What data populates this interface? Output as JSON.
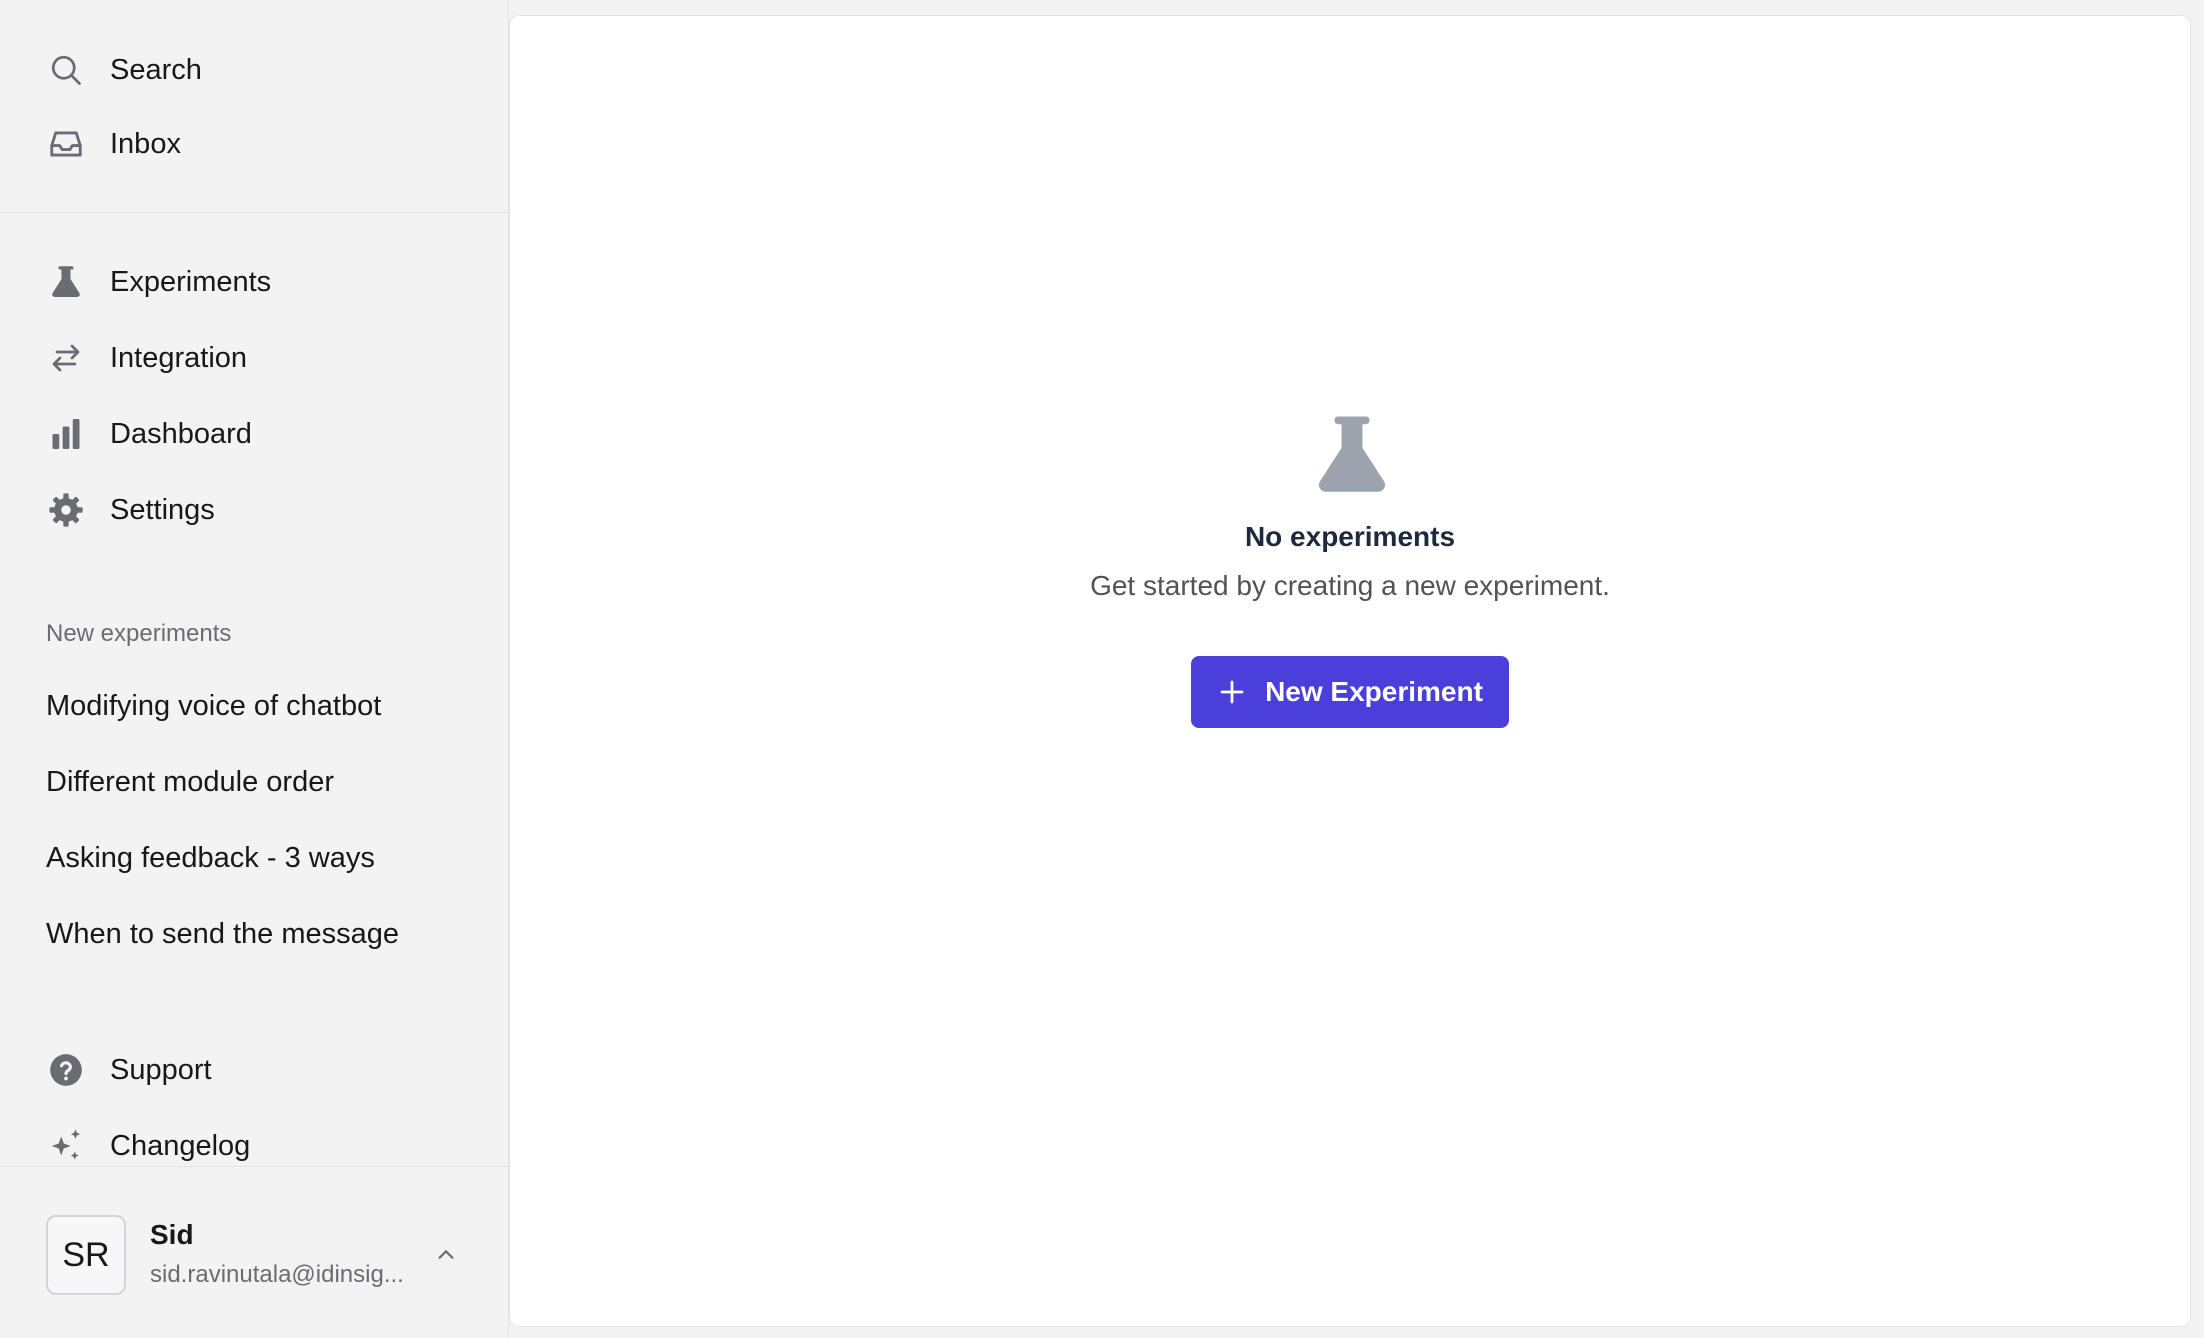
{
  "sidebar": {
    "top_nav": [
      {
        "label": "Search",
        "icon": "search-icon"
      },
      {
        "label": "Inbox",
        "icon": "inbox-icon"
      }
    ],
    "main_nav": [
      {
        "label": "Experiments",
        "icon": "beaker-icon"
      },
      {
        "label": "Integration",
        "icon": "arrows-right-left-icon"
      },
      {
        "label": "Dashboard",
        "icon": "bar-chart-icon"
      },
      {
        "label": "Settings",
        "icon": "gear-icon"
      }
    ],
    "section_label": "New experiments",
    "experiments": [
      "Modifying voice of chatbot",
      "Different module order",
      "Asking feedback - 3 ways",
      "When to send the message"
    ],
    "bottom_nav": [
      {
        "label": "Support",
        "icon": "question-circle-icon"
      },
      {
        "label": "Changelog",
        "icon": "sparkles-icon"
      }
    ],
    "user": {
      "initials": "SR",
      "name": "Sid",
      "email": "sid.ravinutala@idinsig..."
    }
  },
  "main": {
    "empty_state": {
      "icon": "beaker-icon",
      "title": "No experiments",
      "subtitle": "Get started by creating a new experiment.",
      "button_label": "New Experiment"
    }
  },
  "colors": {
    "accent": "#4a3fdb",
    "icon_gray": "#6b6b74",
    "empty_icon": "#9ca3af"
  }
}
